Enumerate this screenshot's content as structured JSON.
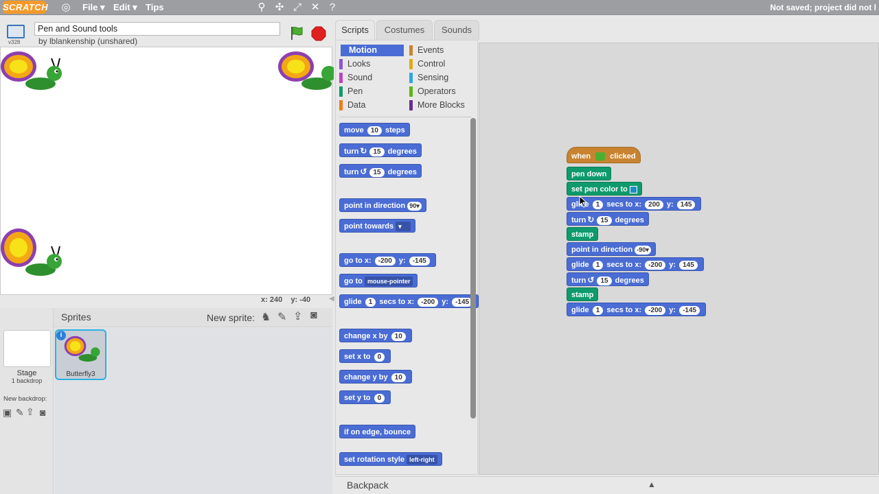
{
  "menubar": {
    "logo": "SCRATCH",
    "file": "File ▾",
    "edit": "Edit ▾",
    "tips": "Tips",
    "status": "Not saved; project did not l"
  },
  "stage_header": {
    "project_title": "Pen and Sound tools",
    "byline": "by lblankenship (unshared)",
    "version": "v328"
  },
  "stage": {
    "x_label": "x:",
    "x_value": "240",
    "y_label": "y:",
    "y_value": "-40"
  },
  "sprite_pane": {
    "title": "Sprites",
    "new_sprite_label": "New sprite:",
    "stage_label": "Stage",
    "backdrop_count": "1 backdrop",
    "new_backdrop_label": "New backdrop:",
    "sprites": [
      {
        "name": "Butterfly3"
      }
    ]
  },
  "tabs": [
    "Scripts",
    "Costumes",
    "Sounds"
  ],
  "categories": [
    {
      "name": "Motion",
      "color": "#4a6cd4"
    },
    {
      "name": "Looks",
      "color": "#8a55d7"
    },
    {
      "name": "Sound",
      "color": "#bb42c3"
    },
    {
      "name": "Pen",
      "color": "#0e9a6c"
    },
    {
      "name": "Data",
      "color": "#ee7d16"
    },
    {
      "name": "Events",
      "color": "#c88330"
    },
    {
      "name": "Control",
      "color": "#e1a91a"
    },
    {
      "name": "Sensing",
      "color": "#2ca5e2"
    },
    {
      "name": "Operators",
      "color": "#5cb712"
    },
    {
      "name": "More Blocks",
      "color": "#632d99"
    }
  ],
  "palette_blocks": {
    "move": {
      "pre": "move",
      "n": "10",
      "post": "steps"
    },
    "turn_cw": {
      "pre": "turn",
      "n": "15",
      "post": "degrees"
    },
    "turn_ccw": {
      "pre": "turn",
      "n": "15",
      "post": "degrees"
    },
    "point_dir": {
      "pre": "point in direction",
      "n": "90▾"
    },
    "point_towards": {
      "pre": "point towards"
    },
    "goto_xy": {
      "pre": "go to x:",
      "x": "-200",
      "mid": "y:",
      "y": "-145"
    },
    "goto": {
      "pre": "go to",
      "opt": "mouse-pointer"
    },
    "glide": {
      "pre": "glide",
      "n": "1",
      "mid": "secs to x:",
      "x": "-200",
      "mid2": "y:",
      "y": "-145"
    },
    "change_x": {
      "pre": "change x by",
      "n": "10"
    },
    "set_x": {
      "pre": "set x to",
      "n": "0"
    },
    "change_y": {
      "pre": "change y by",
      "n": "10"
    },
    "set_y": {
      "pre": "set y to",
      "n": "0"
    },
    "bounce": {
      "pre": "if on edge, bounce"
    },
    "rotation": {
      "pre": "set rotation style",
      "opt": "left-right"
    }
  },
  "script": {
    "hat": {
      "pre": "when",
      "post": "clicked"
    },
    "pen_down": "pen down",
    "set_pen_color": "set pen color to",
    "glide1": {
      "pre": "glide",
      "n": "1",
      "mid": "secs to x:",
      "x": "200",
      "mid2": "y:",
      "y": "145"
    },
    "turn1": {
      "pre": "turn",
      "n": "15",
      "post": "degrees"
    },
    "stamp1": "stamp",
    "point_dir": {
      "pre": "point in direction",
      "n": "-90▾"
    },
    "glide2": {
      "pre": "glide",
      "n": "1",
      "mid": "secs to x:",
      "x": "-200",
      "mid2": "y:",
      "y": "145"
    },
    "turn2": {
      "pre": "turn",
      "n": "15",
      "post": "degrees"
    },
    "stamp2": "stamp",
    "glide3": {
      "pre": "glide",
      "n": "1",
      "mid": "secs to x:",
      "x": "-200",
      "mid2": "y:",
      "y": "-145"
    }
  },
  "backpack": {
    "label": "Backpack"
  }
}
